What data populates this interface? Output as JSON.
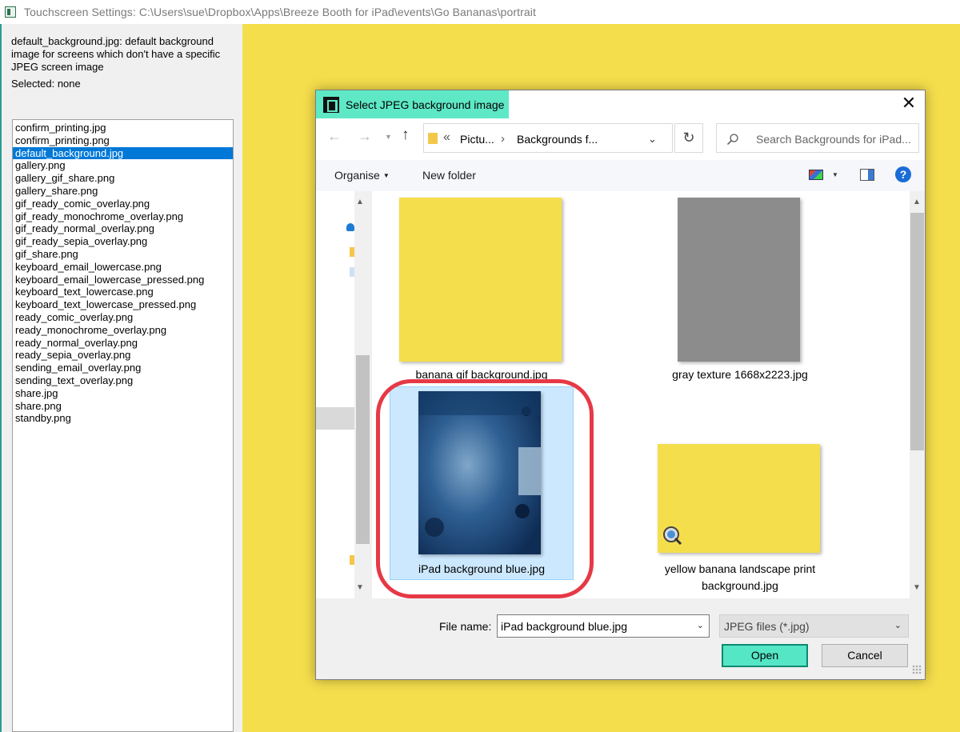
{
  "window": {
    "title": "Touchscreen Settings: C:\\Users\\sue\\Dropbox\\Apps\\Breeze Booth for iPad\\events\\Go Bananas\\portrait"
  },
  "left_panel": {
    "description": "default_background.jpg: default background image for screens which don't have a specific JPEG screen image",
    "selected_label": "Selected: none",
    "files": [
      "confirm_printing.jpg",
      "confirm_printing.png",
      "default_background.jpg",
      "gallery.png",
      "gallery_gif_share.png",
      "gallery_share.png",
      "gif_ready_comic_overlay.png",
      "gif_ready_monochrome_overlay.png",
      "gif_ready_normal_overlay.png",
      "gif_ready_sepia_overlay.png",
      "gif_share.png",
      "keyboard_email_lowercase.png",
      "keyboard_email_lowercase_pressed.png",
      "keyboard_text_lowercase.png",
      "keyboard_text_lowercase_pressed.png",
      "ready_comic_overlay.png",
      "ready_monochrome_overlay.png",
      "ready_normal_overlay.png",
      "ready_sepia_overlay.png",
      "sending_email_overlay.png",
      "sending_text_overlay.png",
      "share.jpg",
      "share.png",
      "standby.png"
    ],
    "selected_index": 2
  },
  "dialog": {
    "title": "Select JPEG background image",
    "close_glyph": "✕",
    "address": {
      "left_quote": "«",
      "segments": [
        "Pictu...",
        "Backgrounds f..."
      ],
      "separator": "›"
    },
    "search_placeholder": "Search Backgrounds for iPad...",
    "toolbar": {
      "organise": "Organise",
      "new_folder": "New folder",
      "help": "?"
    },
    "files": [
      {
        "name": "banana gif background.jpg",
        "color": "#f5de4c"
      },
      {
        "name": "gray texture 1668x2223.jpg",
        "color": "#8c8c8c"
      },
      {
        "name": "iPad background blue.jpg",
        "color": "#1f4f82",
        "selected": true
      },
      {
        "name": "yellow banana landscape print background.jpg",
        "color": "#f5de4c"
      }
    ],
    "file_name_label": "File name:",
    "file_name_value": "iPad background blue.jpg",
    "filter_value": "JPEG files (*.jpg)",
    "open_label": "Open",
    "cancel_label": "Cancel"
  },
  "colors": {
    "accent": "#5ee8c6",
    "selection": "#0078d7",
    "highlight_circle": "#e63946",
    "preview_yellow": "#f5de4c"
  }
}
